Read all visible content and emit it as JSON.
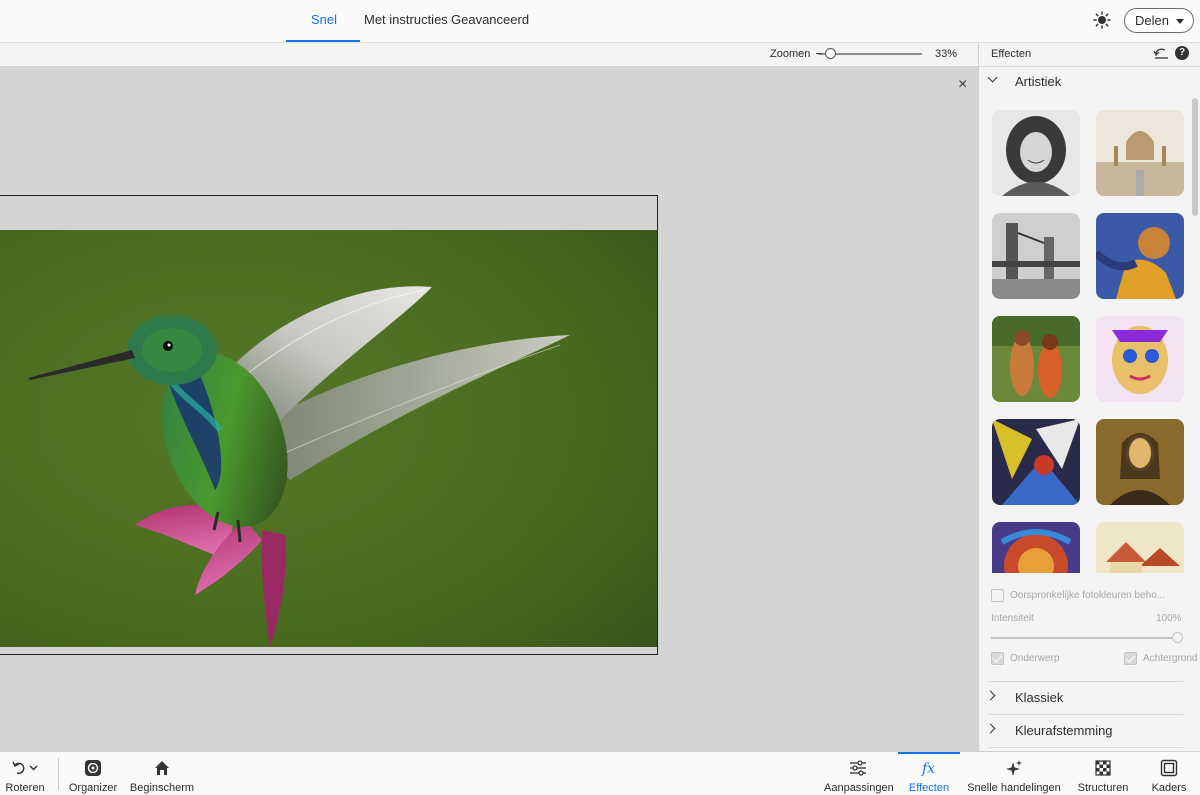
{
  "topbar": {
    "tabs": [
      {
        "label": "Snel",
        "active": true
      },
      {
        "label": "Met instructies",
        "active": false
      },
      {
        "label": "Geavanceerd",
        "active": false
      }
    ],
    "share_label": "Delen"
  },
  "zoom": {
    "label": "Zoomen",
    "value_text": "33%",
    "value": 0.33
  },
  "canvas": {
    "close_glyph": "×"
  },
  "panel": {
    "title": "Effecten",
    "sections": [
      {
        "label": "Artistiek",
        "expanded": true
      },
      {
        "label": "Klassiek",
        "expanded": false
      },
      {
        "label": "Kleurafstemming",
        "expanded": false
      }
    ],
    "keep_colors_label": "Oorspronkelijke fotokleuren beho...",
    "intensity_label": "Intensiteit",
    "intensity_value": "100%",
    "subject_label": "Onderwerp",
    "background_label": "Achtergrond"
  },
  "bottombar": {
    "items": [
      {
        "label": "Roteren",
        "icon": "rotate-icon"
      },
      {
        "label": "Organizer",
        "icon": "organizer-icon"
      },
      {
        "label": "Beginscherm",
        "icon": "home-icon"
      },
      {
        "label": "Aanpassingen",
        "icon": "sliders-icon"
      },
      {
        "label": "Effecten",
        "icon": "fx-icon",
        "active": true
      },
      {
        "label": "Snelle handelingen",
        "icon": "sparkle-icon"
      },
      {
        "label": "Structuren",
        "icon": "texture-icon"
      },
      {
        "label": "Kaders",
        "icon": "frame-icon"
      }
    ]
  },
  "colors": {
    "accent": "#1473e6",
    "canvas_bg": "#d4d4d4",
    "photo_bg": "#4b6a1c"
  }
}
